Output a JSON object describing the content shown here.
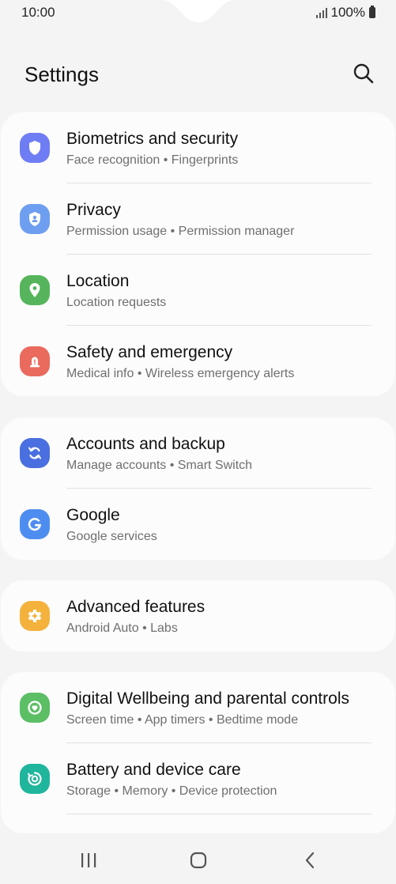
{
  "status": {
    "time": "10:00",
    "battery": "100%"
  },
  "header": {
    "title": "Settings"
  },
  "groups": [
    [
      {
        "title": "Biometrics and security",
        "subtitle": "Face recognition  •  Fingerprints",
        "icon": "shield-icon",
        "color": "#6f7df4"
      },
      {
        "title": "Privacy",
        "subtitle": "Permission usage  •  Permission manager",
        "icon": "privacy-icon",
        "color": "#6e9ef0"
      },
      {
        "title": "Location",
        "subtitle": "Location requests",
        "icon": "location-pin-icon",
        "color": "#56b55c"
      },
      {
        "title": "Safety and emergency",
        "subtitle": "Medical info  •  Wireless emergency alerts",
        "icon": "alarm-icon",
        "color": "#ea6a5e"
      }
    ],
    [
      {
        "title": "Accounts and backup",
        "subtitle": "Manage accounts  •  Smart Switch",
        "icon": "sync-icon",
        "color": "#4a6fe0"
      },
      {
        "title": "Google",
        "subtitle": "Google services",
        "icon": "google-g-icon",
        "color": "#4e8df0"
      }
    ],
    [
      {
        "title": "Advanced features",
        "subtitle": "Android Auto  •  Labs",
        "icon": "puzzle-gear-icon",
        "color": "#f4b23c"
      }
    ],
    [
      {
        "title": "Digital Wellbeing and parental controls",
        "subtitle": "Screen time  •  App timers  •  Bedtime mode",
        "icon": "heart-circle-icon",
        "color": "#5cbf66"
      },
      {
        "title": "Battery and device care",
        "subtitle": "Storage  •  Memory  •  Device protection",
        "icon": "device-care-icon",
        "color": "#20b59d"
      }
    ]
  ]
}
